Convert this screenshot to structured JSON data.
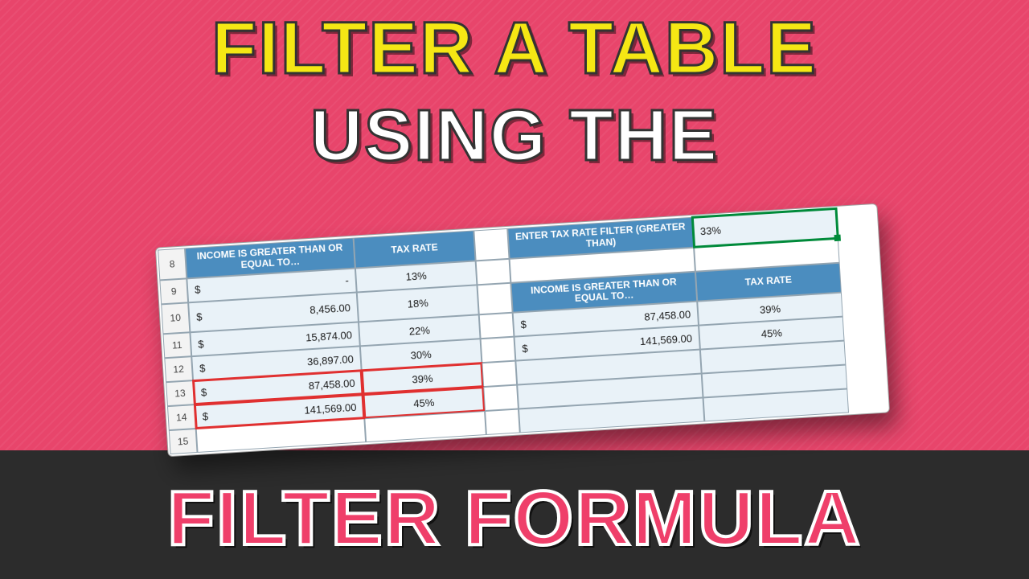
{
  "headline": {
    "line1": "FILTER A TABLE",
    "line2": "USING THE",
    "line3": "FILTER FORMULA"
  },
  "sheet": {
    "row_numbers": [
      "8",
      "9",
      "10",
      "11",
      "12",
      "13",
      "14",
      "15"
    ],
    "left": {
      "header_income": "INCOME IS GREATER THAN OR EQUAL TO…",
      "header_rate": "TAX RATE",
      "rows": [
        {
          "income": "-",
          "rate": "13%"
        },
        {
          "income": "8,456.00",
          "rate": "18%"
        },
        {
          "income": "15,874.00",
          "rate": "22%"
        },
        {
          "income": "36,897.00",
          "rate": "30%"
        },
        {
          "income": "87,458.00",
          "rate": "39%"
        },
        {
          "income": "141,569.00",
          "rate": "45%"
        }
      ]
    },
    "right": {
      "filter_label": "ENTER TAX RATE FILTER (GREATER THAN)",
      "filter_value": "33%",
      "header_income": "INCOME IS GREATER THAN OR EQUAL TO…",
      "header_rate": "TAX RATE",
      "rows": [
        {
          "income": "87,458.00",
          "rate": "39%"
        },
        {
          "income": "141,569.00",
          "rate": "45%"
        }
      ]
    }
  }
}
